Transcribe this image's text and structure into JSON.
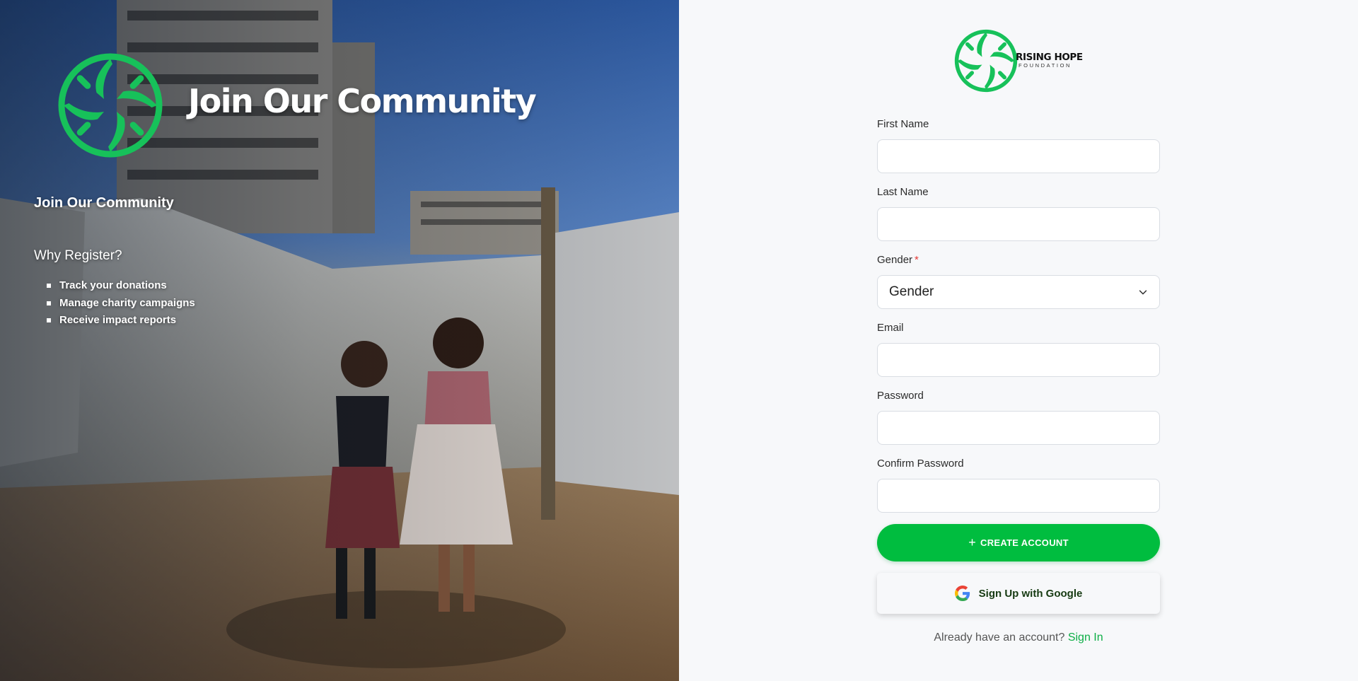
{
  "brand": {
    "name": "RISING HOPE",
    "tagline": "FOUNDATION",
    "primary_color": "#00bd3f",
    "logo_icon": "hands-circle-logo"
  },
  "hero": {
    "title": "Join Our Community",
    "subtitle": "Join Our Community",
    "why_heading": "Why Register?",
    "benefits": [
      "Track your donations",
      "Manage charity campaigns",
      "Receive impact reports"
    ],
    "photo_description_icon": "children-playing-photo"
  },
  "form": {
    "first_name": {
      "label": "First Name",
      "value": ""
    },
    "last_name": {
      "label": "Last Name",
      "value": ""
    },
    "gender": {
      "label": "Gender",
      "required_mark": "*",
      "selected": "Gender"
    },
    "email": {
      "label": "Email",
      "value": ""
    },
    "password": {
      "label": "Password",
      "value": ""
    },
    "confirm_password": {
      "label": "Confirm Password",
      "value": ""
    }
  },
  "actions": {
    "create_account_label": "CREATE ACCOUNT",
    "create_account_icon": "+",
    "google_label": "Sign Up with Google",
    "signin_prompt": "Already have an account?",
    "signin_link": "Sign In"
  }
}
